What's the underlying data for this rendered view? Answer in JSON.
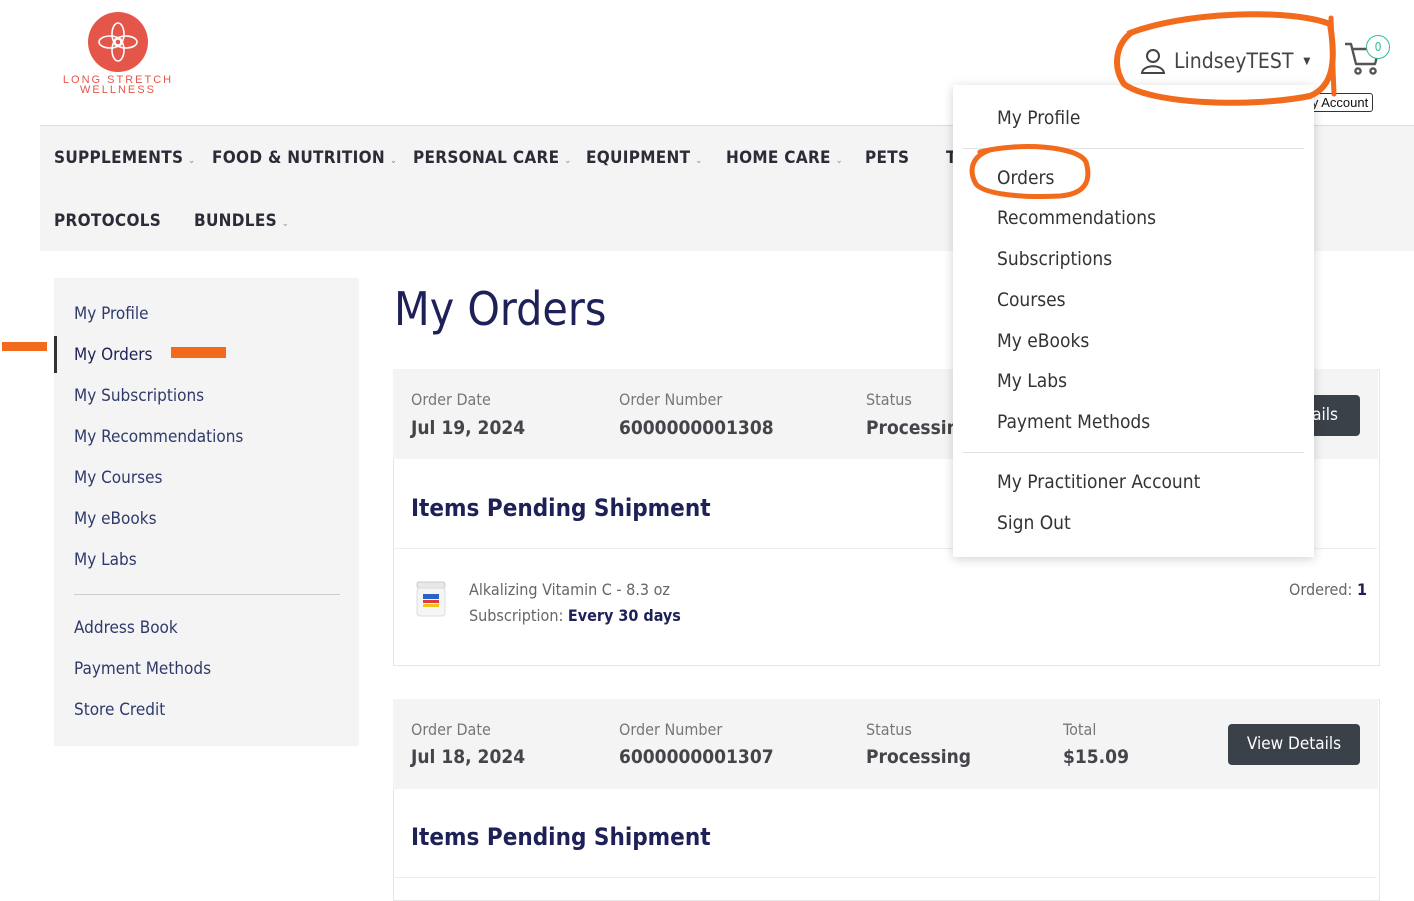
{
  "brand": {
    "line1": "LONG STRETCH",
    "line2": "WELLNESS",
    "color": "#e4564a"
  },
  "header": {
    "account_name": "LindseyTEST",
    "cart_count": "0",
    "tooltip": "My Account"
  },
  "nav": {
    "row1": [
      "SUPPLEMENTS",
      "FOOD & NUTRITION",
      "PERSONAL CARE",
      "EQUIPMENT",
      "HOME CARE",
      "PETS",
      "T"
    ],
    "row2": [
      "PROTOCOLS",
      "BUNDLES"
    ]
  },
  "sidebar": {
    "items": [
      "My Profile",
      "My Orders",
      "My Subscriptions",
      "My Recommendations",
      "My Courses",
      "My eBooks",
      "My Labs"
    ],
    "items2": [
      "Address Book",
      "Payment Methods",
      "Store Credit"
    ],
    "active": "My Orders"
  },
  "main": {
    "title": "My Orders"
  },
  "labels": {
    "order_date": "Order Date",
    "order_number": "Order Number",
    "status": "Status",
    "total": "Total",
    "pending": "Items Pending Shipment",
    "view_details": "View Details",
    "view_details_partial": "ails",
    "subscription": "Subscription:",
    "ordered": "Ordered:"
  },
  "orders": [
    {
      "date": "Jul 19, 2024",
      "number": "6000000001308",
      "status": "Processing",
      "item": {
        "name": "Alkalizing Vitamin C - 8.3 oz",
        "subscription": "Every 30 days",
        "qty": "1"
      }
    },
    {
      "date": "Jul 18, 2024",
      "number": "6000000001307",
      "status": "Processing",
      "total": "$15.09"
    }
  ],
  "dropdown": {
    "group1": [
      "My Profile"
    ],
    "group2": [
      "Orders",
      "Recommendations",
      "Subscriptions",
      "Courses",
      "My eBooks",
      "My Labs",
      "Payment Methods"
    ],
    "group3": [
      "My Practitioner Account",
      "Sign Out"
    ]
  },
  "colors": {
    "accent": "#1e2157",
    "annotation": "#f26a1b",
    "badge": "#2bbd9a",
    "button": "#3b4149"
  }
}
